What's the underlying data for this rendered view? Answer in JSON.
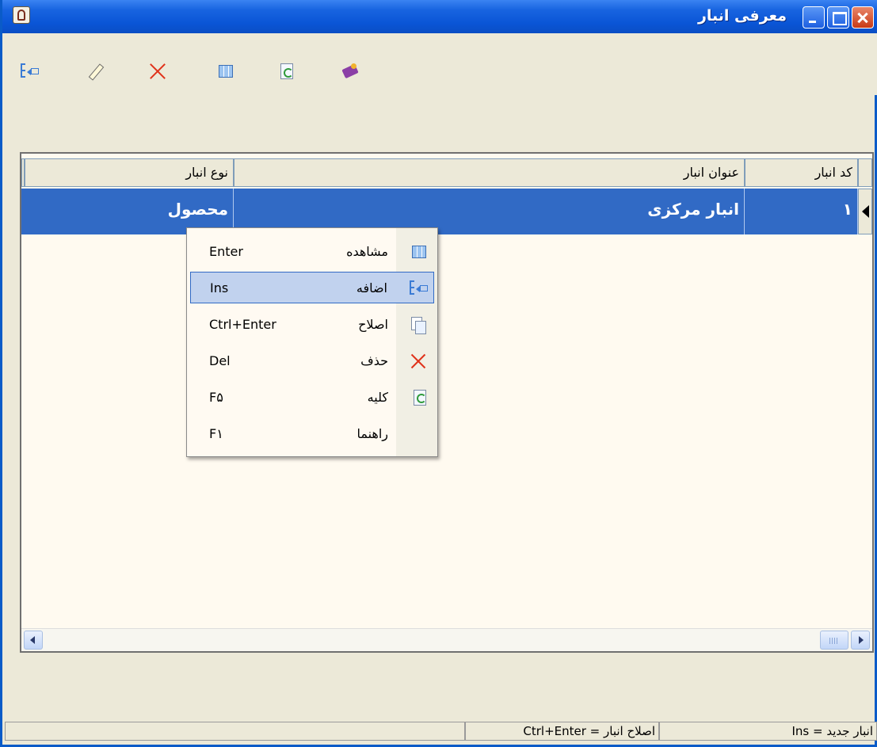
{
  "window": {
    "title": "معرفی انبار",
    "buttons": [
      "minimize-button",
      "maximize-button",
      "close-button"
    ]
  },
  "toolbar": {
    "icons": [
      "add-icon",
      "edit-icon",
      "delete-icon",
      "view-grid-icon",
      "refresh-icon",
      "help-book-icon"
    ]
  },
  "grid": {
    "columns": [
      {
        "key": "code",
        "label": "کد انبار"
      },
      {
        "key": "title",
        "label": "عنوان انبار"
      },
      {
        "key": "type",
        "label": "نوع انبار"
      }
    ],
    "rows": [
      {
        "code": "۱",
        "title": "انبار مرکزی",
        "type": "محصول",
        "selected": true
      }
    ]
  },
  "context_menu": {
    "items": [
      {
        "label": "مشاهده",
        "shortcut": "Enter",
        "icon": "view-grid-icon",
        "highlighted": false
      },
      {
        "label": "اضافه",
        "shortcut": "Ins",
        "icon": "add-icon",
        "highlighted": true
      },
      {
        "label": "اصلاح",
        "shortcut": "Ctrl+Enter",
        "icon": "copy-edit-icon",
        "highlighted": false
      },
      {
        "label": "حذف",
        "shortcut": "Del",
        "icon": "delete-icon",
        "highlighted": false
      },
      {
        "label": "کلیه",
        "shortcut": "F۵",
        "icon": "refresh-icon",
        "highlighted": false
      },
      {
        "label": "راهنما",
        "shortcut": "F۱",
        "icon": "",
        "highlighted": false
      }
    ]
  },
  "statusbar": {
    "new_hint": "انبار جدید = Ins",
    "edit_hint": "اصلاح انبار = Ctrl+Enter",
    "empty": ""
  },
  "colors": {
    "selection": "#316ac5",
    "titlebar": "#0a55d6",
    "menu_highlight": "#c1d2ee"
  }
}
